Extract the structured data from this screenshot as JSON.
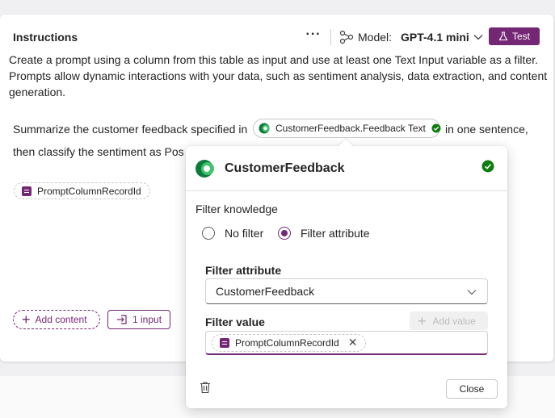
{
  "header": {
    "title": "Instructions",
    "more_label": "···",
    "model_label": "Model:",
    "model_value": "GPT-4.1 mini",
    "test_label": "Test"
  },
  "instructions": {
    "text": "Create a prompt using a column from this table as input and use at least one Text Input variable as a filter. Prompts allow dynamic interactions with your data, such as sentiment analysis, data extraction, and content generation."
  },
  "prompt": {
    "line1_before": "Summarize the customer feedback  specified in",
    "knowledge_chip": "CustomerFeedback.Feedback Text",
    "line1_after": "in one sentence,",
    "line2": "then classify the sentiment as Posit",
    "variable_chip": "PromptColumnRecordId"
  },
  "footer": {
    "add_content_label": "Add content",
    "input_label": "1 input"
  },
  "popup": {
    "title": "CustomerFeedback",
    "filter_knowledge_label": "Filter knowledge",
    "radio_options": [
      {
        "label": "No filter",
        "checked": false
      },
      {
        "label": "Filter attribute",
        "checked": true
      }
    ],
    "filter_attribute_label": "Filter attribute",
    "filter_attribute_value": "CustomerFeedback",
    "filter_value_label": "Filter value",
    "add_value_label": "Add value",
    "value_chip": "PromptColumnRecordId",
    "close_label": "Close"
  },
  "colors": {
    "accent": "#742774",
    "success": "#107c10",
    "dataverse_green": "#0d7a3e"
  }
}
